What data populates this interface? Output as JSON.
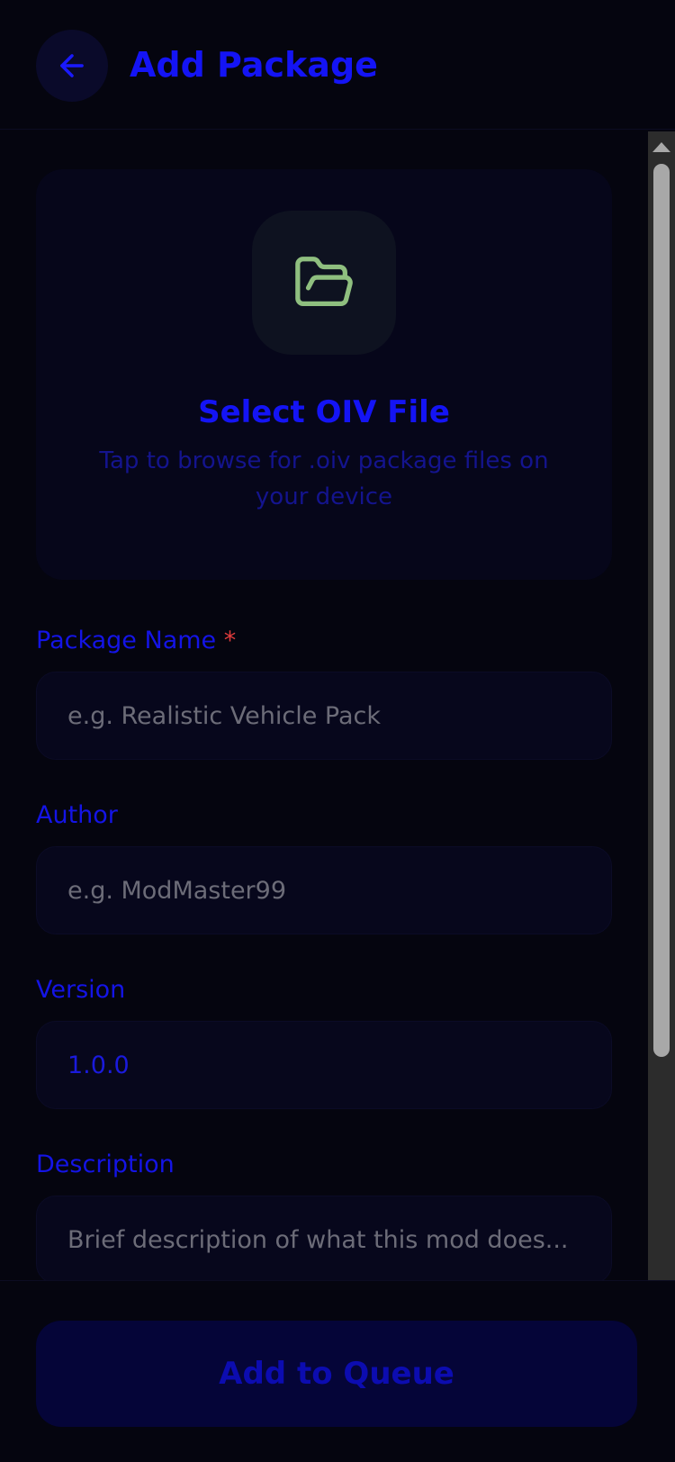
{
  "header": {
    "title": "Add Package",
    "back_icon": "arrow-left-icon"
  },
  "file_picker": {
    "icon": "folder-open-icon",
    "title": "Select OIV File",
    "subtitle": "Tap to browse for .oiv package files on your device"
  },
  "form": {
    "package_name": {
      "label": "Package Name",
      "required_mark": "*",
      "placeholder": "e.g. Realistic Vehicle Pack",
      "value": ""
    },
    "author": {
      "label": "Author",
      "placeholder": "e.g. ModMaster99",
      "value": ""
    },
    "version": {
      "label": "Version",
      "value": "1.0.0"
    },
    "description": {
      "label": "Description",
      "placeholder": "Brief description of what this mod does...",
      "value": ""
    }
  },
  "footer": {
    "submit_label": "Add to Queue"
  },
  "colors": {
    "background": "#05050f",
    "accent": "#1414f5",
    "required": "#e03c3c",
    "folder_icon": "#8fbf7f"
  }
}
